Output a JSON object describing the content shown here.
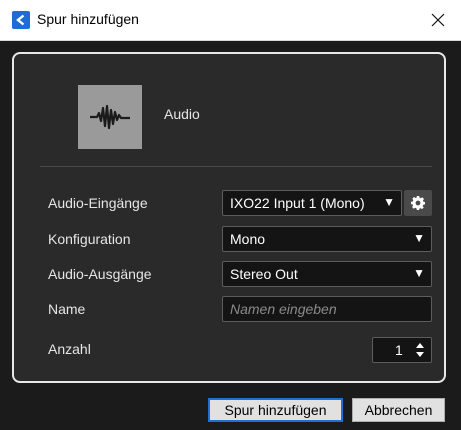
{
  "window": {
    "title": "Spur hinzufügen",
    "icon": "cubase-icon",
    "close_icon": "close-icon"
  },
  "track_type": {
    "icon": "audio-waveform-icon",
    "label": "Audio"
  },
  "form": {
    "inputs_label": "Audio-Eingänge",
    "inputs_value": "IXO22 Input 1 (Mono)",
    "config_label": "Konfiguration",
    "config_value": "Mono",
    "outputs_label": "Audio-Ausgänge",
    "outputs_value": "Stereo Out",
    "name_label": "Name",
    "name_placeholder": "Namen eingeben",
    "count_label": "Anzahl",
    "count_value": "1"
  },
  "buttons": {
    "add": "Spur hinzufügen",
    "cancel": "Abbrechen"
  },
  "colors": {
    "accent": "#1f6fd6",
    "panel_bg": "#2a2a2a",
    "field_bg": "#141414"
  }
}
